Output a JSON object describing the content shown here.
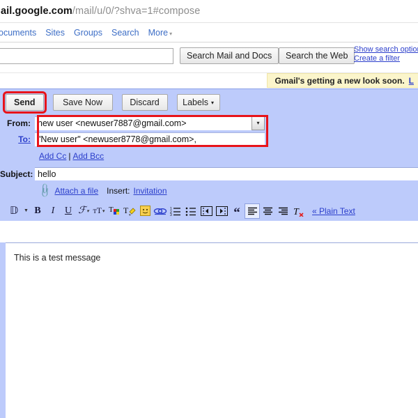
{
  "browser": {
    "url_host": "ail.google.com",
    "url_path": "/mail/u/0/?shva=1#compose"
  },
  "gnav": {
    "items": [
      {
        "label": "ocuments",
        "name": "nav-documents"
      },
      {
        "label": "Sites",
        "name": "nav-sites"
      },
      {
        "label": "Groups",
        "name": "nav-groups"
      },
      {
        "label": "Search",
        "name": "nav-search"
      },
      {
        "label": "More",
        "name": "nav-more"
      }
    ],
    "more_caret": "▾"
  },
  "search": {
    "query": "",
    "placeholder": "",
    "search_mail_docs_label": "Search Mail and Docs",
    "search_web_label": "Search the Web",
    "show_search_options": "Show search options",
    "create_filter": "Create a filter"
  },
  "promo": {
    "text": "Gmail's getting a new look soon.",
    "link": "L"
  },
  "compose": {
    "buttons": {
      "send": "Send",
      "save_now": "Save Now",
      "discard": "Discard",
      "labels": "Labels",
      "labels_caret": "▾"
    },
    "from": {
      "label": "From:",
      "value": "new user <newuser7887@gmail.com>",
      "dropdown_caret": "▾"
    },
    "to": {
      "label": "To:",
      "value": "\"New user\" <newuser8778@gmail.com>,"
    },
    "cc_links": {
      "add_cc": "Add Cc",
      "separator": "|",
      "add_bcc": "Add Bcc"
    },
    "subject": {
      "label": "Subject:",
      "value": "hello"
    },
    "attach": {
      "attach_label": "Attach a file",
      "insert_label": "Insert:",
      "invitation_label": "Invitation"
    },
    "body": {
      "text": "This is a test message"
    },
    "plain_text_link": "« Plain Text"
  },
  "toolbar": {
    "icons": [
      {
        "name": "font-style-icon",
        "glyph": "ƒ",
        "caret": true
      },
      {
        "name": "bold-icon",
        "glyph": "B",
        "caret": false
      },
      {
        "name": "italic-icon",
        "glyph": "I",
        "caret": false
      },
      {
        "name": "underline-icon",
        "glyph": "U",
        "caret": false
      },
      {
        "name": "font-family-icon",
        "glyph": "F",
        "caret": true
      },
      {
        "name": "font-size-icon",
        "glyph": "tT",
        "caret": true
      },
      {
        "name": "text-color-icon",
        "glyph": "T",
        "caret": false
      },
      {
        "name": "highlight-color-icon",
        "glyph": "T",
        "caret": false
      },
      {
        "name": "emoticon-icon",
        "glyph": "☺",
        "caret": false
      },
      {
        "name": "insert-link-icon",
        "glyph": "∞",
        "caret": false
      },
      {
        "name": "numbered-list-icon",
        "glyph": "",
        "caret": false
      },
      {
        "name": "bulleted-list-icon",
        "glyph": "",
        "caret": false
      },
      {
        "name": "outdent-icon",
        "glyph": "",
        "caret": false
      },
      {
        "name": "indent-icon",
        "glyph": "",
        "caret": false
      },
      {
        "name": "quote-icon",
        "glyph": "“",
        "caret": false
      },
      {
        "name": "align-left-icon",
        "glyph": "",
        "caret": false
      },
      {
        "name": "align-center-icon",
        "glyph": "",
        "caret": false
      },
      {
        "name": "align-right-icon",
        "glyph": "",
        "caret": false
      },
      {
        "name": "remove-formatting-icon",
        "glyph": "T",
        "caret": false
      }
    ]
  },
  "colors": {
    "compose_bg": "#bdcbfb",
    "link": "#2b3ecb",
    "nav_link": "#3d6ec6",
    "highlight_box": "#e8131a",
    "promo_bg": "#fbf5cb"
  }
}
